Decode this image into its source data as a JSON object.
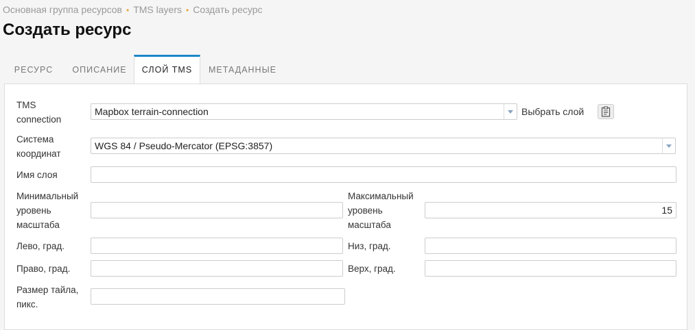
{
  "breadcrumb": {
    "items": [
      "Основная группа ресурсов",
      "TMS layers",
      "Создать ресурс"
    ],
    "separator": "•"
  },
  "page": {
    "title": "Создать ресурс"
  },
  "tabs": [
    {
      "label": "Ресурс"
    },
    {
      "label": "Описание"
    },
    {
      "label": "Слой TMS"
    },
    {
      "label": "Метаданные"
    }
  ],
  "form": {
    "connection": {
      "label_line1": "TMS",
      "label_line2": "connection",
      "value": "Mapbox terrain-connection",
      "pick_label": "Выбрать слой",
      "pick_icon": "clipboard-icon"
    },
    "srs": {
      "label_line1": "Система",
      "label_line2": "координат",
      "value": "WGS 84 / Pseudo-Mercator (EPSG:3857)"
    },
    "layer_name": {
      "label": "Имя слоя",
      "value": ""
    },
    "min_zoom": {
      "label_line1": "Минимальный",
      "label_line2": "уровень",
      "label_line3": "масштаба",
      "value": ""
    },
    "max_zoom": {
      "label_line1": "Максимальный",
      "label_line2": "уровень",
      "label_line3": "масштаба",
      "value": "15"
    },
    "left": {
      "label": "Лево, град.",
      "value": ""
    },
    "bottom": {
      "label": "Низ, град.",
      "value": ""
    },
    "right": {
      "label": "Право, град.",
      "value": ""
    },
    "top": {
      "label": "Верх, град.",
      "value": ""
    },
    "tile_size": {
      "label_line1": "Размер тайла,",
      "label_line2": "пикс.",
      "value": ""
    }
  },
  "colors": {
    "accent": "#1b87c8",
    "separator": "#e8a33a"
  }
}
